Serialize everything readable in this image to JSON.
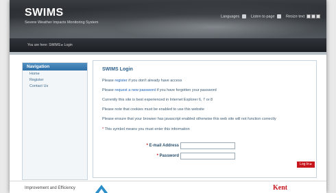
{
  "header": {
    "title": "SWIMS",
    "subtitle": "Severe Weather Impacts Monitoring System",
    "languages": "Languages",
    "listen": "Listen to page",
    "resize": "Resize text"
  },
  "breadcrumb": {
    "text": "You are here:  SWIMS  ▸ Login"
  },
  "sidebar": {
    "heading": "Navigation",
    "items": [
      {
        "label": "Home"
      },
      {
        "label": "Register"
      },
      {
        "label": "Contact Us"
      }
    ]
  },
  "login": {
    "title": "SWIMS Login",
    "line1_pre": "Please",
    "line1_link": "register",
    "line1_post": "if you don't already have access",
    "line2_pre": "Please",
    "line2_link": "request a new password",
    "line2_post": "if you have forgotten your password",
    "line3": "Currently this site is best experienced in Internet Explorer 6, 7 or 8",
    "line4": "Please note that cookies must be enabled to use this website",
    "line5": "Please ensure that your browser has javascript enabled otherwise this web site will not function correctly",
    "req_symbol": "*",
    "req_text": "This symbol means you must enter this information",
    "email_label": "E-mail Address",
    "password_label": "Password",
    "email_value": "",
    "password_value": "",
    "button_label": "Log In"
  },
  "footer": {
    "left_text": "Improvement and Efficiency",
    "right_logo": "Kent"
  },
  "colors": {
    "accent": "#2e6fa6",
    "button": "#c8161d",
    "link": "#1d63b8"
  }
}
